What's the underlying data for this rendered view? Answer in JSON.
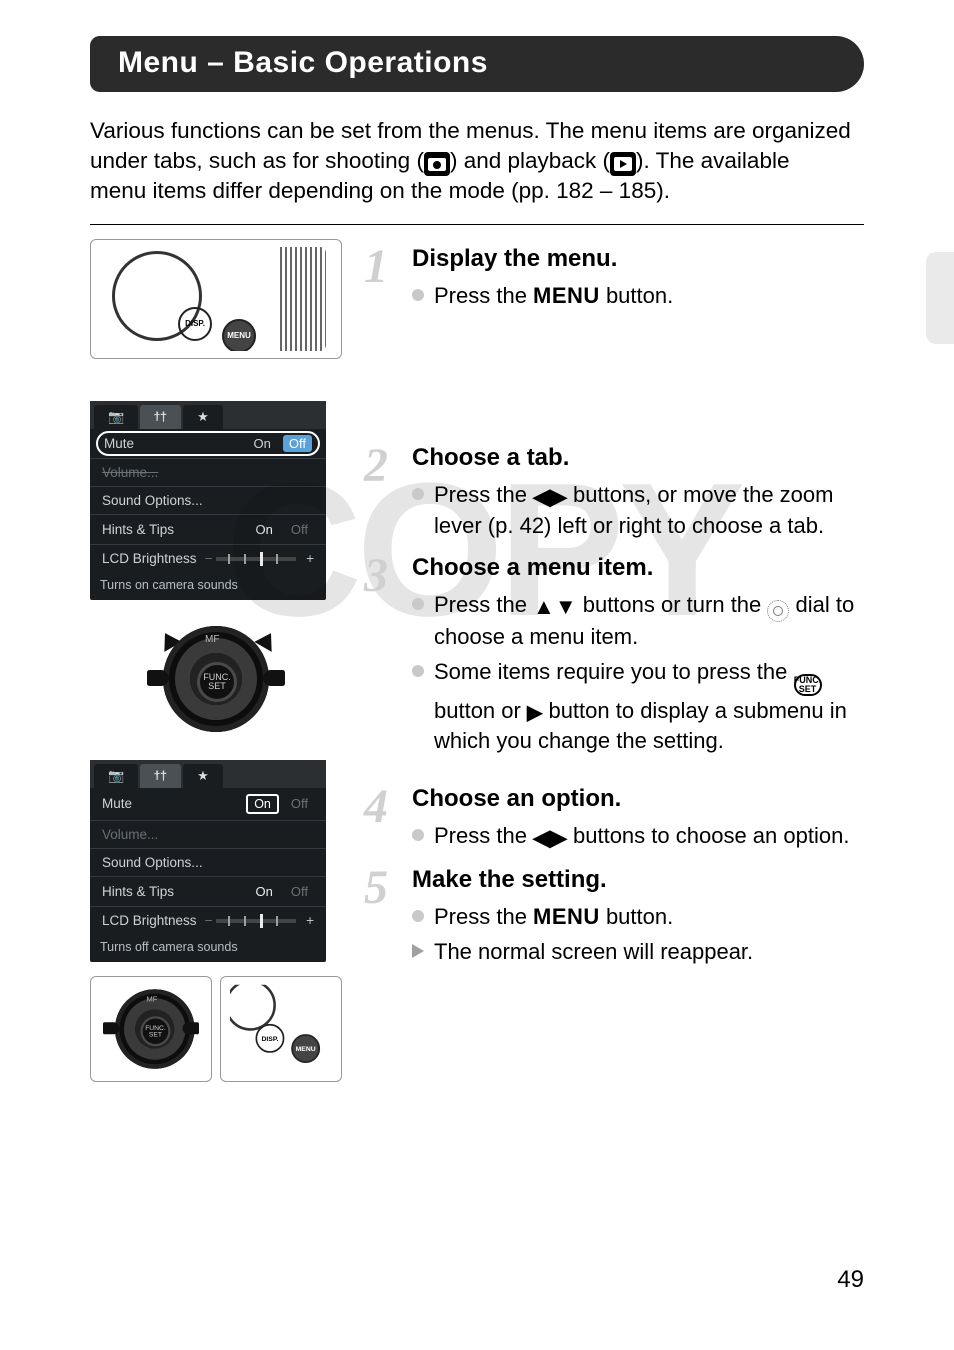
{
  "title": "Menu – Basic Operations",
  "intro": {
    "line1a": "Various functions can be set from the menus. The menu items are organized",
    "line2a": "under tabs, such as for shooting (",
    "line2b": ") and playback (",
    "line2c": "). The available",
    "line3": "menu items differ depending on the mode (pp. 182 – 185)."
  },
  "steps": {
    "s1": {
      "num": "1",
      "title": "Display the menu.",
      "b1a": "Press the ",
      "menu_label": "MENU",
      "b1b": " button."
    },
    "s2": {
      "num": "2",
      "title": "Choose a tab.",
      "b1a": "Press the ",
      "b1b": " buttons, or move the zoom lever (p. 42) left or right to choose a tab."
    },
    "s3": {
      "num": "3",
      "title": "Choose a menu item.",
      "b1a": "Press the ",
      "b1b": " buttons or turn the ",
      "b1c": " dial to choose a menu item.",
      "b2a": "Some items require you to press the ",
      "b2b": " button or ",
      "b2c": " button to display a submenu in which you change the setting."
    },
    "s4": {
      "num": "4",
      "title": "Choose an option.",
      "b1a": "Press the ",
      "b1b": " buttons to choose an option."
    },
    "s5": {
      "num": "5",
      "title": "Make the setting.",
      "b1a": "Press the ",
      "menu_label": "MENU",
      "b1b": " button.",
      "b2": "The normal screen will reappear."
    }
  },
  "mock_menu_1": {
    "rows": {
      "mute": "Mute",
      "on": "On",
      "off": "Off",
      "volume": "Volume...",
      "sound": "Sound Options...",
      "hints": "Hints & Tips",
      "hints_val": "On",
      "hints_off": "Off",
      "lcd": "LCD Brightness",
      "footer": "Turns on camera sounds"
    }
  },
  "mock_menu_2": {
    "rows": {
      "mute": "Mute",
      "on": "On",
      "off": "Off",
      "volume": "Volume...",
      "sound": "Sound Options...",
      "hints": "Hints & Tips",
      "hints_val": "On",
      "hints_off": "Off",
      "lcd": "LCD Brightness",
      "footer": "Turns off camera sounds"
    }
  },
  "dial": {
    "mf": "MF",
    "func": "FUNC.",
    "set": "SET"
  },
  "cam_back": {
    "disp": "DISP.",
    "menu": "MENU"
  },
  "func_badge": {
    "line1": "FUNC.",
    "line2": "SET"
  },
  "watermark": "COPY",
  "page_number": "49"
}
